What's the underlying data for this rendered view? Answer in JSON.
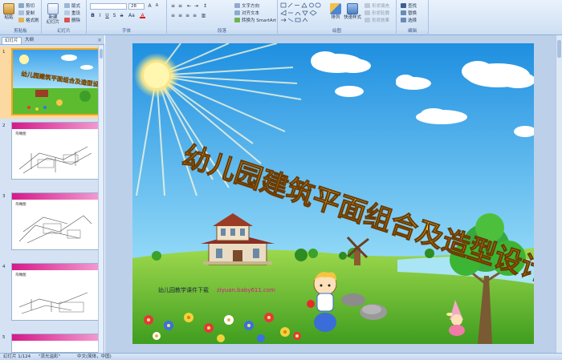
{
  "ribbon": {
    "clipboard": {
      "label": "剪贴板",
      "paste": "粘贴",
      "cut": "剪切",
      "copy": "复制",
      "format_painter": "格式刷"
    },
    "slides": {
      "label": "幻灯片",
      "new_slide": "新建\n幻灯片",
      "layout": "版式",
      "reset": "重设",
      "delete": "删除"
    },
    "font": {
      "label": "字体",
      "size": "28"
    },
    "paragraph": {
      "label": "段落",
      "text_direction": "文字方向",
      "align_text": "对齐文本",
      "smartart": "转换为 SmartArt"
    },
    "drawing": {
      "label": "绘图",
      "arrange": "排列",
      "quick_styles": "快速样式",
      "shape_fill": "形状填充",
      "shape_outline": "形状轮廓",
      "shape_effects": "形状效果"
    },
    "editing": {
      "label": "编辑",
      "find": "查找",
      "replace": "替换",
      "select": "选择"
    }
  },
  "panel": {
    "tab_slides": "幻灯片",
    "tab_outline": "大纲",
    "close": "×",
    "thumbnails": [
      {
        "number": "1",
        "selected": true
      },
      {
        "number": "2",
        "selected": false,
        "caption": "鸟瞰图"
      },
      {
        "number": "3",
        "selected": false,
        "caption": "鸟瞰图"
      },
      {
        "number": "4",
        "selected": false,
        "caption": "鸟瞰图"
      },
      {
        "number": "5",
        "selected": false
      }
    ]
  },
  "slide": {
    "title": "幼儿园建筑平面组合及造型设计",
    "footer_label": "幼儿园教学课件下载",
    "footer_url": "ziyuan.baby611.com"
  },
  "status": {
    "slide_info": "幻灯片 1/124",
    "theme": "\"流光溢彩\"",
    "language": "中文(简体，中国)"
  },
  "colors": {
    "sky_top": "#1e8fe0",
    "sky_bottom": "#8fd7f7",
    "grass": "#59b82c",
    "title_gold": "#d49a1a",
    "footer_link": "#d6198a"
  }
}
